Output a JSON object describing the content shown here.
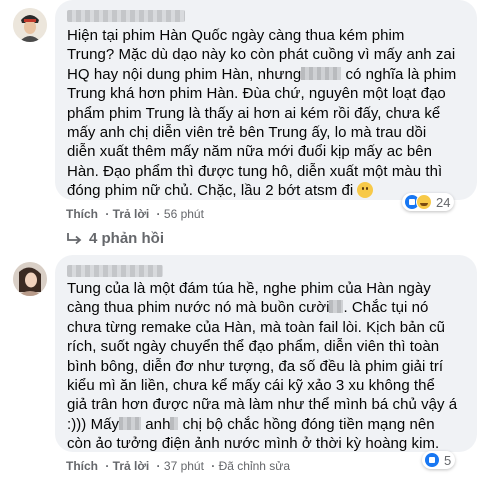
{
  "comments": [
    {
      "avatar": "user-avatar-icon",
      "text": {
        "l1": "Hiện tại phim Hàn Quốc ngày càng thua kém phim",
        "l2": "Trung? Mặc dù dạo này ko còn phát cuồng vì mấy anh zai",
        "l3a": "HQ hay nội dung phim Hàn, nhưng",
        "l3b": " có nghĩa là phim",
        "l4": "Trung khá hơn phim Hàn. Đùa chứ, nguyên một loạt đạo",
        "l5": "phẩm phim Trung là thấy ai hơn ai kém rồi đấy, chưa kể",
        "l6": "mấy anh chị diễn viên trẻ bên Trung ấy, lo mà trau dồi",
        "l7": "diễn xuất thêm mấy năm nữa mới đuổi kịp mấy ac bên",
        "l8": "Hàn. Đạo phẩm thì được tung hô, diễn xuất một màu thì",
        "l9": "đóng phim nữ chủ. Chặc, lầu 2 bớt atsm đi "
      },
      "actions": {
        "like": "Thích",
        "reply": "Trả lời",
        "time": "56 phút"
      },
      "reactions": {
        "icons": [
          "like-icon",
          "haha-icon"
        ],
        "count": "24"
      }
    },
    {
      "avatar": "user-avatar-icon",
      "text": {
        "l1": "Tung của là một đám túa hề, nghe phim của Hàn ngày",
        "l2": "càng thua phim nước nó mà buồn cười",
        "l2b": ". Chắc tụi nó",
        "l3": "chưa từng remake của Hàn, mà toàn fail lòi. Kịch bản cũ",
        "l4": "rích, suốt ngày chuyển thể đạo phẩm, diễn viên thì toàn",
        "l5": "bình bông, diễn đơ như tượng, đa số đều là phim giải trí",
        "l6": "kiểu mì ăn liền, chưa kể mấy cái kỹ xảo 3 xu không thể",
        "l7": "giả trân hơn được nữa mà làm như thể mình bá chủ vậy á",
        "l8a": ":))) Mấy",
        "l8b": " anh",
        "l8c": " chị bộ chắc hồng đóng tiền mạng nên",
        "l9": "còn ảo tưởng điện ảnh nước mình ở thời kỳ hoàng kim."
      },
      "actions": {
        "like": "Thích",
        "reply": "Trả lời",
        "time": "37 phút",
        "edited": "Đã chỉnh sửa"
      },
      "reactions": {
        "icons": [
          "like-icon"
        ],
        "count": "5"
      }
    }
  ],
  "replies_link": "4 phản hồi"
}
